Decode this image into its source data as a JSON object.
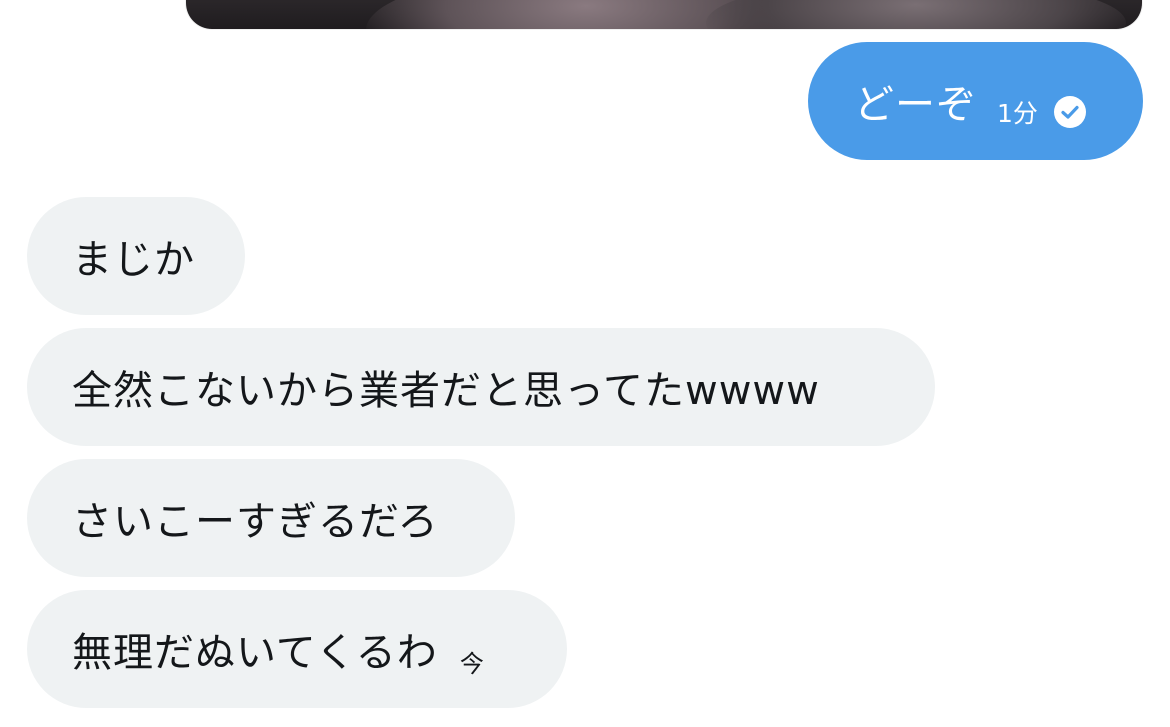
{
  "conversation": {
    "outgoing": [
      {
        "text": "どーぞ",
        "time": "1分",
        "status_icon": "check-circle-icon"
      }
    ],
    "incoming": [
      {
        "text": "まじか"
      },
      {
        "text": "全然こないから業者だと思ってたwwww"
      },
      {
        "text": "さいこーすぎるだろ"
      },
      {
        "text": "無理だぬいてくるわ",
        "time": "今"
      }
    ]
  },
  "colors": {
    "outgoing_bubble": "#4a9be8",
    "incoming_bubble": "#eff2f3",
    "text_dark": "#14171a"
  }
}
